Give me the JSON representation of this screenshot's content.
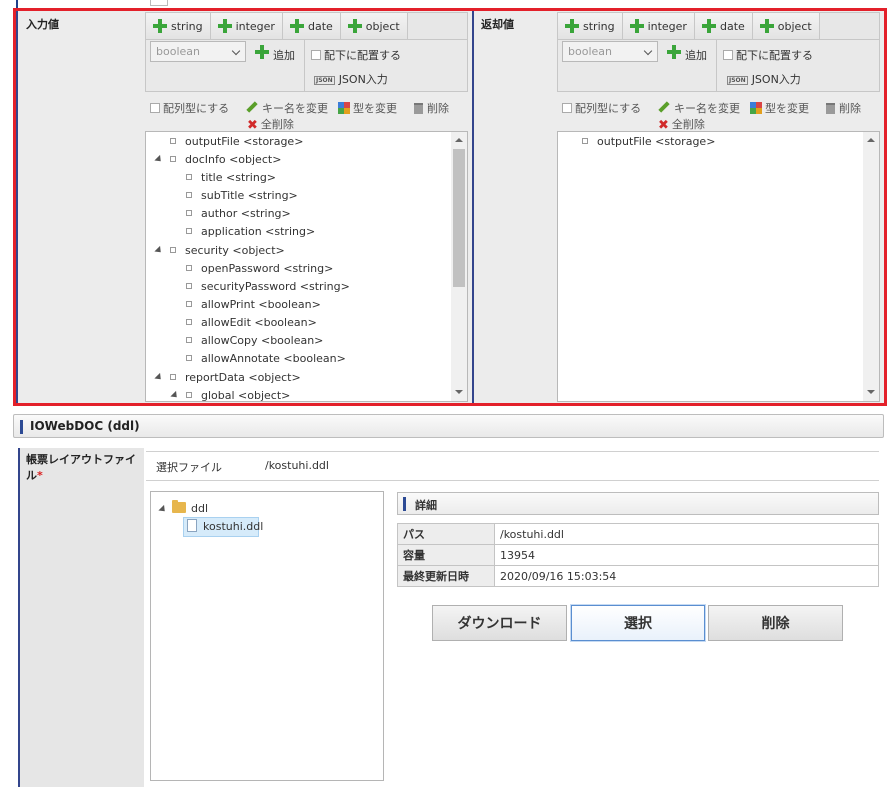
{
  "mapping": {
    "left": {
      "label": "入力値",
      "type_buttons": [
        "string",
        "integer",
        "date",
        "object"
      ],
      "type_select": "boolean",
      "add_label": "追加",
      "child_checkbox": "配下に配置する",
      "json_label": "JSON入力",
      "array_checkbox": "配列型にする",
      "rename_label": "キー名を変更",
      "retype_label": "型を変更",
      "delete_label": "削除",
      "delete_all_label": "全削除",
      "tree": [
        "outputFile <storage>",
        "docInfo <object>",
        "title <string>",
        "subTitle <string>",
        "author <string>",
        "application <string>",
        "security <object>",
        "openPassword <string>",
        "securityPassword <string>",
        "allowPrint <boolean>",
        "allowEdit <boolean>",
        "allowCopy <boolean>",
        "allowAnnotate <boolean>",
        "reportData <object>",
        "global <object>"
      ]
    },
    "right": {
      "label": "返却値",
      "type_buttons": [
        "string",
        "integer",
        "date",
        "object"
      ],
      "type_select": "boolean",
      "add_label": "追加",
      "child_checkbox": "配下に配置する",
      "json_label": "JSON入力",
      "array_checkbox": "配列型にする",
      "rename_label": "キー名を変更",
      "retype_label": "型を変更",
      "delete_label": "削除",
      "delete_all_label": "全削除",
      "tree": [
        "outputFile <storage>"
      ]
    }
  },
  "section": {
    "title": "IOWebDOC (ddl)",
    "field_label": "帳票レイアウトファイル",
    "required_mark": "*",
    "selected_label": "選択ファイル",
    "selected_value": "/kostuhi.ddl",
    "folder": "ddl",
    "file": "kostuhi.ddl",
    "detail_title": "詳細",
    "details": [
      {
        "key": "パス",
        "value": "/kostuhi.ddl"
      },
      {
        "key": "容量",
        "value": "13954"
      },
      {
        "key": "最終更新日時",
        "value": "2020/09/16 15:03:54"
      }
    ],
    "buttons": {
      "download": "ダウンロード",
      "select": "選択",
      "delete": "削除"
    }
  },
  "colors": {
    "highlight": "#e3202a",
    "accent": "#33458c",
    "add_icon": "#3aa53a"
  }
}
